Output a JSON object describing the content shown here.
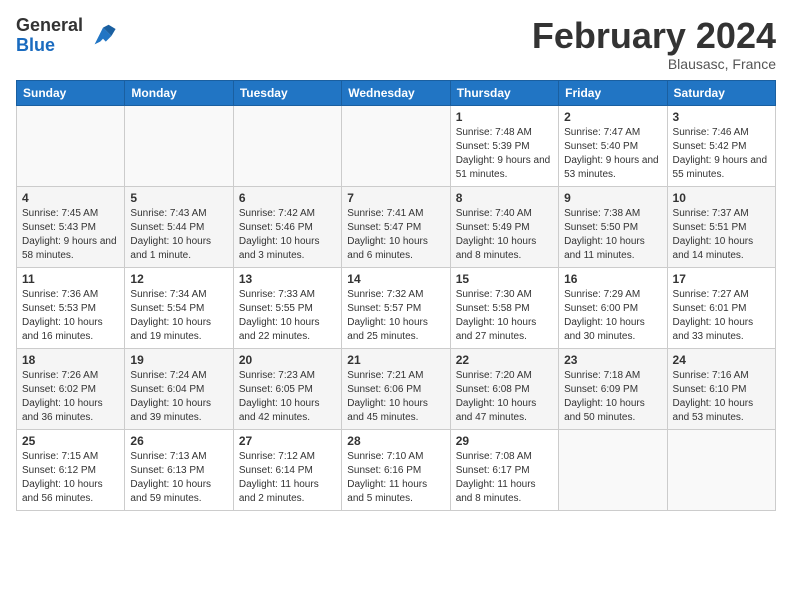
{
  "header": {
    "logo_general": "General",
    "logo_blue": "Blue",
    "month_title": "February 2024",
    "location": "Blausasc, France"
  },
  "days_of_week": [
    "Sunday",
    "Monday",
    "Tuesday",
    "Wednesday",
    "Thursday",
    "Friday",
    "Saturday"
  ],
  "weeks": [
    [
      {
        "day": "",
        "info": ""
      },
      {
        "day": "",
        "info": ""
      },
      {
        "day": "",
        "info": ""
      },
      {
        "day": "",
        "info": ""
      },
      {
        "day": "1",
        "info": "Sunrise: 7:48 AM\nSunset: 5:39 PM\nDaylight: 9 hours and 51 minutes."
      },
      {
        "day": "2",
        "info": "Sunrise: 7:47 AM\nSunset: 5:40 PM\nDaylight: 9 hours and 53 minutes."
      },
      {
        "day": "3",
        "info": "Sunrise: 7:46 AM\nSunset: 5:42 PM\nDaylight: 9 hours and 55 minutes."
      }
    ],
    [
      {
        "day": "4",
        "info": "Sunrise: 7:45 AM\nSunset: 5:43 PM\nDaylight: 9 hours and 58 minutes."
      },
      {
        "day": "5",
        "info": "Sunrise: 7:43 AM\nSunset: 5:44 PM\nDaylight: 10 hours and 1 minute."
      },
      {
        "day": "6",
        "info": "Sunrise: 7:42 AM\nSunset: 5:46 PM\nDaylight: 10 hours and 3 minutes."
      },
      {
        "day": "7",
        "info": "Sunrise: 7:41 AM\nSunset: 5:47 PM\nDaylight: 10 hours and 6 minutes."
      },
      {
        "day": "8",
        "info": "Sunrise: 7:40 AM\nSunset: 5:49 PM\nDaylight: 10 hours and 8 minutes."
      },
      {
        "day": "9",
        "info": "Sunrise: 7:38 AM\nSunset: 5:50 PM\nDaylight: 10 hours and 11 minutes."
      },
      {
        "day": "10",
        "info": "Sunrise: 7:37 AM\nSunset: 5:51 PM\nDaylight: 10 hours and 14 minutes."
      }
    ],
    [
      {
        "day": "11",
        "info": "Sunrise: 7:36 AM\nSunset: 5:53 PM\nDaylight: 10 hours and 16 minutes."
      },
      {
        "day": "12",
        "info": "Sunrise: 7:34 AM\nSunset: 5:54 PM\nDaylight: 10 hours and 19 minutes."
      },
      {
        "day": "13",
        "info": "Sunrise: 7:33 AM\nSunset: 5:55 PM\nDaylight: 10 hours and 22 minutes."
      },
      {
        "day": "14",
        "info": "Sunrise: 7:32 AM\nSunset: 5:57 PM\nDaylight: 10 hours and 25 minutes."
      },
      {
        "day": "15",
        "info": "Sunrise: 7:30 AM\nSunset: 5:58 PM\nDaylight: 10 hours and 27 minutes."
      },
      {
        "day": "16",
        "info": "Sunrise: 7:29 AM\nSunset: 6:00 PM\nDaylight: 10 hours and 30 minutes."
      },
      {
        "day": "17",
        "info": "Sunrise: 7:27 AM\nSunset: 6:01 PM\nDaylight: 10 hours and 33 minutes."
      }
    ],
    [
      {
        "day": "18",
        "info": "Sunrise: 7:26 AM\nSunset: 6:02 PM\nDaylight: 10 hours and 36 minutes."
      },
      {
        "day": "19",
        "info": "Sunrise: 7:24 AM\nSunset: 6:04 PM\nDaylight: 10 hours and 39 minutes."
      },
      {
        "day": "20",
        "info": "Sunrise: 7:23 AM\nSunset: 6:05 PM\nDaylight: 10 hours and 42 minutes."
      },
      {
        "day": "21",
        "info": "Sunrise: 7:21 AM\nSunset: 6:06 PM\nDaylight: 10 hours and 45 minutes."
      },
      {
        "day": "22",
        "info": "Sunrise: 7:20 AM\nSunset: 6:08 PM\nDaylight: 10 hours and 47 minutes."
      },
      {
        "day": "23",
        "info": "Sunrise: 7:18 AM\nSunset: 6:09 PM\nDaylight: 10 hours and 50 minutes."
      },
      {
        "day": "24",
        "info": "Sunrise: 7:16 AM\nSunset: 6:10 PM\nDaylight: 10 hours and 53 minutes."
      }
    ],
    [
      {
        "day": "25",
        "info": "Sunrise: 7:15 AM\nSunset: 6:12 PM\nDaylight: 10 hours and 56 minutes."
      },
      {
        "day": "26",
        "info": "Sunrise: 7:13 AM\nSunset: 6:13 PM\nDaylight: 10 hours and 59 minutes."
      },
      {
        "day": "27",
        "info": "Sunrise: 7:12 AM\nSunset: 6:14 PM\nDaylight: 11 hours and 2 minutes."
      },
      {
        "day": "28",
        "info": "Sunrise: 7:10 AM\nSunset: 6:16 PM\nDaylight: 11 hours and 5 minutes."
      },
      {
        "day": "29",
        "info": "Sunrise: 7:08 AM\nSunset: 6:17 PM\nDaylight: 11 hours and 8 minutes."
      },
      {
        "day": "",
        "info": ""
      },
      {
        "day": "",
        "info": ""
      }
    ]
  ]
}
